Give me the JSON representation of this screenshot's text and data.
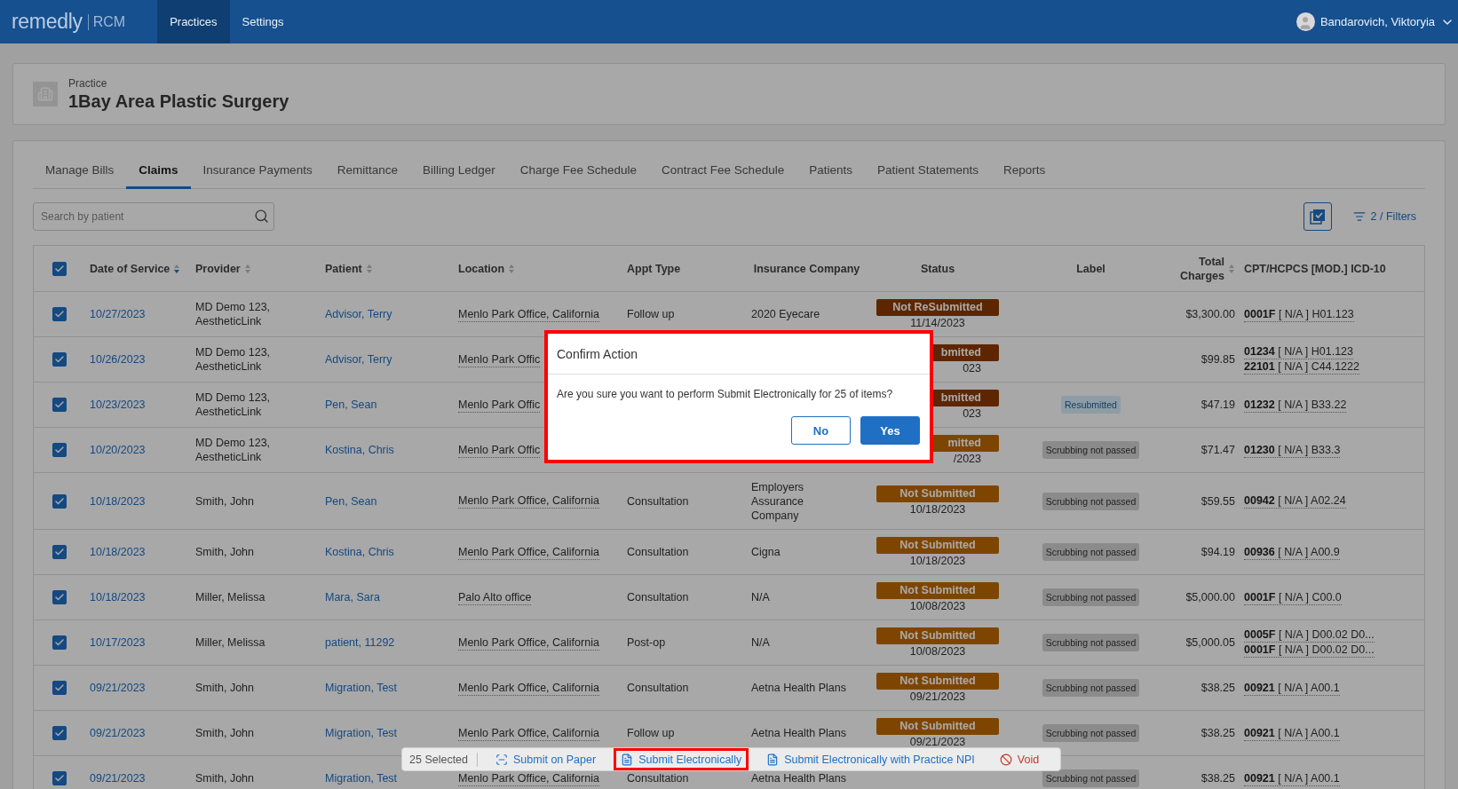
{
  "header": {
    "logo": "remedly",
    "logo_suffix": "RCM",
    "nav": [
      {
        "label": "Practices",
        "selected": true
      },
      {
        "label": "Settings",
        "selected": false
      }
    ],
    "user": "Bandarovich, Viktoryia"
  },
  "practice": {
    "caption": "Practice",
    "name": "1Bay Area Plastic Surgery"
  },
  "tabs": [
    {
      "label": "Manage Bills",
      "selected": false
    },
    {
      "label": "Claims",
      "selected": true
    },
    {
      "label": "Insurance Payments",
      "selected": false
    },
    {
      "label": "Remittance",
      "selected": false
    },
    {
      "label": "Billing Ledger",
      "selected": false
    },
    {
      "label": "Charge Fee Schedule",
      "selected": false
    },
    {
      "label": "Contract Fee Schedule",
      "selected": false
    },
    {
      "label": "Patients",
      "selected": false
    },
    {
      "label": "Patient Statements",
      "selected": false
    },
    {
      "label": "Reports",
      "selected": false
    }
  ],
  "search": {
    "placeholder": "Search by patient"
  },
  "filters": "2 / Filters",
  "table": {
    "select_all": {
      "checked": true
    },
    "columns": [
      {
        "label": "Date of Service",
        "sortable": true,
        "sorted": true
      },
      {
        "label": "Provider",
        "sortable": true,
        "sorted": false
      },
      {
        "label": "Patient",
        "sortable": true,
        "sorted": false
      },
      {
        "label": "Location",
        "sortable": true,
        "sorted": false
      },
      {
        "label": "Appt Type"
      },
      {
        "label": "Insurance Company"
      },
      {
        "label": "Status"
      },
      {
        "label": "Label"
      },
      {
        "label": "Total Charges",
        "sortable": true,
        "sorted": false
      },
      {
        "label": "CPT/HCPCS [MOD.] ICD-10"
      }
    ],
    "rows": [
      {
        "checked": true,
        "date": "10/27/2023",
        "provider": "MD Demo 123, AestheticLink",
        "patient": "Advisor, Terry",
        "location": "Menlo Park Office, California",
        "appt": "Follow up",
        "insurance": "2020 Eyecare",
        "status": {
          "text": "Not ReSubmitted",
          "date": "11/14/2023",
          "kind": "resubmit",
          "cut": false
        },
        "total": "$3,300.00",
        "codes": [
          "**0001F** [ N/A ] H01.123"
        ]
      },
      {
        "checked": true,
        "date": "10/26/2023",
        "provider": "MD Demo 123, AestheticLink",
        "patient": "Advisor, Terry",
        "location": "Menlo Park Offic",
        "status": {
          "text": "bmitted",
          "date": "023",
          "kind": "resubmit",
          "cut": true
        },
        "total": "$99.85",
        "codes": [
          "**01234** [ N/A ] H01.123",
          "**22101** [ N/A ] C44.1222"
        ]
      },
      {
        "checked": true,
        "date": "10/23/2023",
        "provider": "MD Demo 123, AestheticLink",
        "patient": "Pen, Sean",
        "location": "Menlo Park Offic",
        "status": {
          "text": "bmitted",
          "date": "023",
          "kind": "resubmit",
          "cut": true
        },
        "label": {
          "text": "Resubmitted",
          "kind": "info"
        },
        "total": "$47.19",
        "codes": [
          "**01232** [ N/A ] B33.22"
        ]
      },
      {
        "checked": true,
        "date": "10/20/2023",
        "provider": "MD Demo 123, AestheticLink",
        "patient": "Kostina, Chris",
        "location": "Menlo Park Offic",
        "status": {
          "text": "mitted",
          "date": "/2023",
          "kind": "pending",
          "cut": true
        },
        "label": {
          "text": "Scrubbing not passed",
          "kind": "muted"
        },
        "total": "$71.47",
        "codes": [
          "**01230** [ N/A ] B33.3"
        ]
      },
      {
        "checked": true,
        "date": "10/18/2023",
        "provider": "Smith, John",
        "patient": "Pen, Sean",
        "location": "Menlo Park Office, California",
        "appt": "Consultation",
        "insurance": "Employers Assurance Company",
        "status": {
          "text": "Not Submitted",
          "date": "10/18/2023",
          "kind": "pending",
          "cut": false
        },
        "label": {
          "text": "Scrubbing not passed",
          "kind": "muted"
        },
        "total": "$59.55",
        "codes": [
          "**00942** [ N/A ] A02.24"
        ]
      },
      {
        "checked": true,
        "date": "10/18/2023",
        "provider": "Smith, John",
        "patient": "Kostina, Chris",
        "location": "Menlo Park Office, California",
        "appt": "Consultation",
        "insurance": "Cigna",
        "status": {
          "text": "Not Submitted",
          "date": "10/18/2023",
          "kind": "pending",
          "cut": false
        },
        "label": {
          "text": "Scrubbing not passed",
          "kind": "muted"
        },
        "total": "$94.19",
        "codes": [
          "**00936** [ N/A ] A00.9"
        ]
      },
      {
        "checked": true,
        "date": "10/18/2023",
        "provider": "Miller, Melissa",
        "patient": "Mara, Sara",
        "location": "Palo Alto office",
        "appt": "Consultation",
        "insurance": "N/A",
        "status": {
          "text": "Not Submitted",
          "date": "10/08/2023",
          "kind": "pending",
          "cut": false
        },
        "label": {
          "text": "Scrubbing not passed",
          "kind": "muted"
        },
        "total": "$5,000.00",
        "codes": [
          "**0001F** [ N/A ] C00.0"
        ]
      },
      {
        "checked": true,
        "date": "10/17/2023",
        "provider": "Miller, Melissa",
        "patient": "patient, 11292",
        "location": "Menlo Park Office, California",
        "appt": "Post-op",
        "insurance": "N/A",
        "status": {
          "text": "Not Submitted",
          "date": "10/08/2023",
          "kind": "pending",
          "cut": false
        },
        "label": {
          "text": "Scrubbing not passed",
          "kind": "muted"
        },
        "total": "$5,000.05",
        "codes": [
          "**0005F** [ N/A ] D00.02 D0...",
          "**0001F** [ N/A ] D00.02 D0..."
        ]
      },
      {
        "checked": true,
        "date": "09/21/2023",
        "provider": "Smith, John",
        "patient": "Migration, Test",
        "location": "Menlo Park Office, California",
        "appt": "Consultation",
        "insurance": "Aetna Health Plans",
        "status": {
          "text": "Not Submitted",
          "date": "09/21/2023",
          "kind": "pending",
          "cut": false
        },
        "label": {
          "text": "Scrubbing not passed",
          "kind": "muted"
        },
        "total": "$38.25",
        "codes": [
          "**00921** [ N/A ] A00.1"
        ]
      },
      {
        "checked": true,
        "date": "09/21/2023",
        "provider": "Smith, John",
        "patient": "Migration, Test",
        "location": "Menlo Park Office, California",
        "appt": "Follow up",
        "insurance": "Aetna Health Plans",
        "status": {
          "text": "Not Submitted",
          "date": "09/21/2023",
          "kind": "pending",
          "cut": false
        },
        "label": {
          "text": "Scrubbing not passed",
          "kind": "muted"
        },
        "total": "$38.25",
        "codes": [
          "**00921** [ N/A ] A00.1"
        ]
      },
      {
        "checked": true,
        "date": "09/21/2023",
        "provider": "Smith, John",
        "patient": "Migration, Test",
        "location": "Menlo Park Office, California",
        "appt": "Consultation",
        "insurance": "Aetna Health Plans",
        "label": {
          "text": "Scrubbing not passed",
          "kind": "muted"
        },
        "total": "$38.25",
        "codes": [
          "**00921** [ N/A ] A00.1"
        ]
      }
    ]
  },
  "action_bar": {
    "count": "25 Selected",
    "actions": [
      {
        "label": "Submit on Paper",
        "kind": "paper",
        "highlighted": false
      },
      {
        "label": "Submit Electronically",
        "kind": "electronic",
        "highlighted": true
      },
      {
        "label": "Submit Electronically with Practice NPI",
        "kind": "electronic",
        "highlighted": false
      },
      {
        "label": "Void",
        "kind": "void",
        "highlighted": false
      }
    ]
  },
  "dialog": {
    "title": "Confirm Action",
    "message": "Are you sure you want to perform Submit Electronically for 25 of items?",
    "highlighted": true,
    "buttons": [
      {
        "label": "No",
        "kind": "secondary"
      },
      {
        "label": "Yes",
        "kind": "primary"
      }
    ]
  }
}
